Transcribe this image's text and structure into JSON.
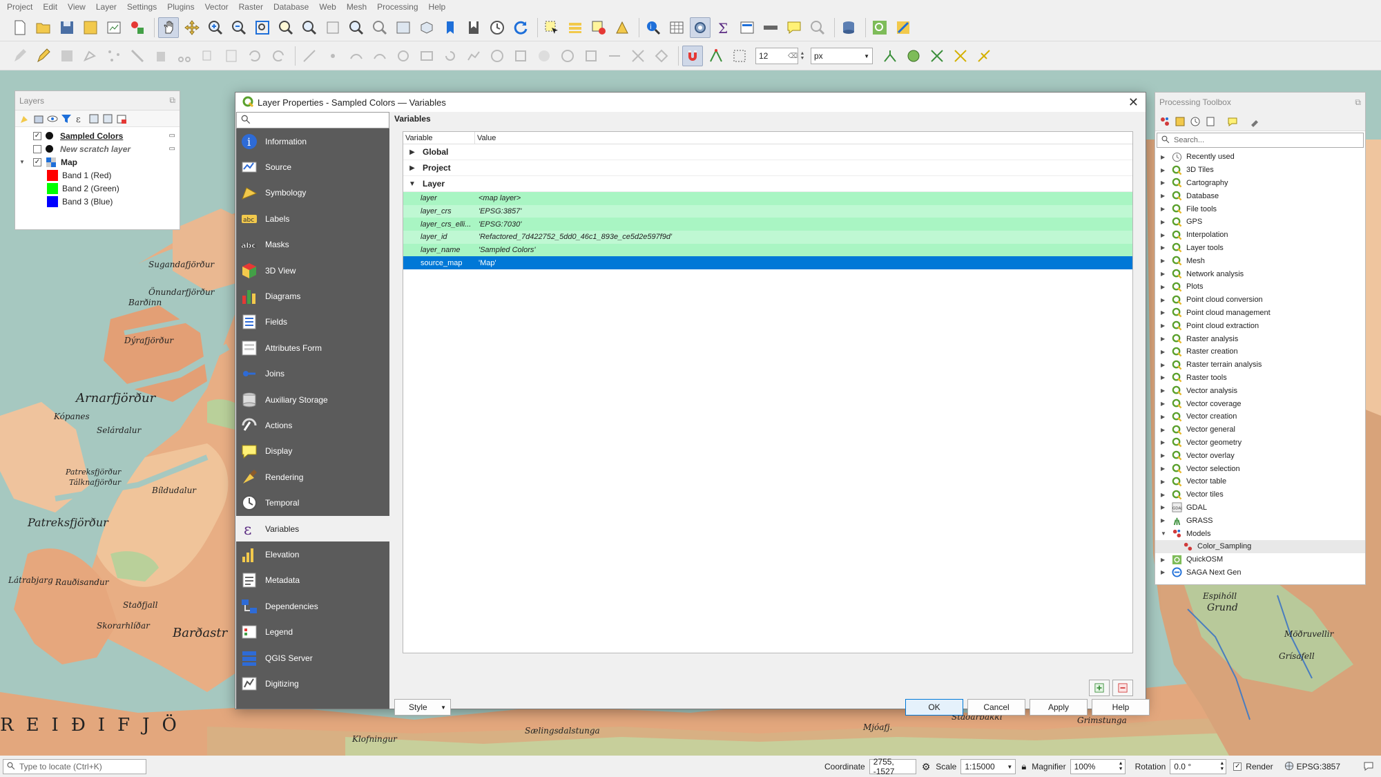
{
  "menus": [
    "Project",
    "Edit",
    "View",
    "Layer",
    "Settings",
    "Plugins",
    "Vector",
    "Raster",
    "Database",
    "Web",
    "Mesh",
    "Processing",
    "Help"
  ],
  "toolbar": {
    "snapping_tolerance": "12",
    "snapping_units": "px"
  },
  "layers_panel": {
    "title": "Layers",
    "items": [
      {
        "label": "Sampled Colors",
        "checked": true
      },
      {
        "label": "New scratch layer",
        "checked": false
      },
      {
        "label": "Map",
        "checked": true
      }
    ],
    "bands": [
      {
        "label": "Band 1 (Red)",
        "color": "#ff0000"
      },
      {
        "label": "Band 2 (Green)",
        "color": "#00ff00"
      },
      {
        "label": "Band 3 (Blue)",
        "color": "#0000ff"
      }
    ]
  },
  "dialog": {
    "title": "Layer Properties - Sampled Colors — Variables",
    "section_title": "Variables",
    "sidebar": [
      {
        "label": "Information",
        "icon": "information-icon"
      },
      {
        "label": "Source",
        "icon": "source-icon"
      },
      {
        "label": "Symbology",
        "icon": "symbology-icon"
      },
      {
        "label": "Labels",
        "icon": "labels-icon"
      },
      {
        "label": "Masks",
        "icon": "masks-icon"
      },
      {
        "label": "3D View",
        "icon": "3d-view-icon"
      },
      {
        "label": "Diagrams",
        "icon": "diagrams-icon"
      },
      {
        "label": "Fields",
        "icon": "fields-icon"
      },
      {
        "label": "Attributes Form",
        "icon": "attributes-form-icon"
      },
      {
        "label": "Joins",
        "icon": "joins-icon"
      },
      {
        "label": "Auxiliary Storage",
        "icon": "auxiliary-storage-icon"
      },
      {
        "label": "Actions",
        "icon": "actions-icon"
      },
      {
        "label": "Display",
        "icon": "display-icon"
      },
      {
        "label": "Rendering",
        "icon": "rendering-icon"
      },
      {
        "label": "Temporal",
        "icon": "temporal-icon"
      },
      {
        "label": "Variables",
        "icon": "variables-icon"
      },
      {
        "label": "Elevation",
        "icon": "elevation-icon"
      },
      {
        "label": "Metadata",
        "icon": "metadata-icon"
      },
      {
        "label": "Dependencies",
        "icon": "dependencies-icon"
      },
      {
        "label": "Legend",
        "icon": "legend-icon"
      },
      {
        "label": "QGIS Server",
        "icon": "qgis-server-icon"
      },
      {
        "label": "Digitizing",
        "icon": "digitizing-icon"
      }
    ],
    "table_headers": {
      "variable": "Variable",
      "value": "Value"
    },
    "groups": [
      {
        "label": "Global",
        "expanded": false
      },
      {
        "label": "Project",
        "expanded": false
      },
      {
        "label": "Layer",
        "expanded": true
      }
    ],
    "layer_variables": [
      {
        "name": "layer",
        "value": "<map layer>"
      },
      {
        "name": "layer_crs",
        "value": "'EPSG:3857'"
      },
      {
        "name": "layer_crs_elli...",
        "value": "'EPSG:7030'"
      },
      {
        "name": "layer_id",
        "value": "'Refactored_7d422752_5dd0_46c1_893e_ce5d2e597f9d'"
      },
      {
        "name": "layer_name",
        "value": "'Sampled Colors'"
      },
      {
        "name": "source_map",
        "value": "'Map'"
      }
    ],
    "buttons": {
      "style": "Style",
      "ok": "OK",
      "cancel": "Cancel",
      "apply": "Apply",
      "help": "Help"
    }
  },
  "processing_toolbox": {
    "title": "Processing Toolbox",
    "search_placeholder": "Search...",
    "items": [
      "Recently used",
      "3D Tiles",
      "Cartography",
      "Database",
      "File tools",
      "GPS",
      "Interpolation",
      "Layer tools",
      "Mesh",
      "Network analysis",
      "Plots",
      "Point cloud conversion",
      "Point cloud management",
      "Point cloud extraction",
      "Raster analysis",
      "Raster creation",
      "Raster terrain analysis",
      "Raster tools",
      "Vector analysis",
      "Vector coverage",
      "Vector creation",
      "Vector general",
      "Vector geometry",
      "Vector overlay",
      "Vector selection",
      "Vector table",
      "Vector tiles",
      "GDAL",
      "GRASS",
      "Models"
    ],
    "model_child": "Color_Sampling",
    "tail_items": [
      "QuickOSM",
      "SAGA Next Gen"
    ]
  },
  "map_labels": [
    "Sugandafjörður",
    "Önundarfjörður",
    "Barðinn",
    "Dýrafjörður",
    "Arnarfjörður",
    "Kópanes",
    "Selárdalur",
    "Patreksfjörður",
    "Tálknafjörður",
    "Bíldudalur",
    "Patreksfjörður",
    "Látrabjarg",
    "Rauðisandur",
    "Skorarhlíðar",
    "Barðastr",
    "Staðfjall",
    "REIÐIFJÖ",
    "Klofningur",
    "Sælingsdalstunga",
    "Mjóafj.",
    "Grund",
    "Espihóll",
    "Möðruvellir",
    "Grísafell",
    "Grimstunga",
    "Staðarbakki"
  ],
  "statusbar": {
    "locate_placeholder": "Type to locate (Ctrl+K)",
    "coordinate_label": "Coordinate",
    "coordinate": "2755, -1527",
    "scale_label": "Scale",
    "scale": "1:15000",
    "magnifier_label": "Magnifier",
    "magnifier": "100%",
    "rotation_label": "Rotation",
    "rotation": "0.0 °",
    "render_label": "Render",
    "crs": "EPSG:3857"
  }
}
